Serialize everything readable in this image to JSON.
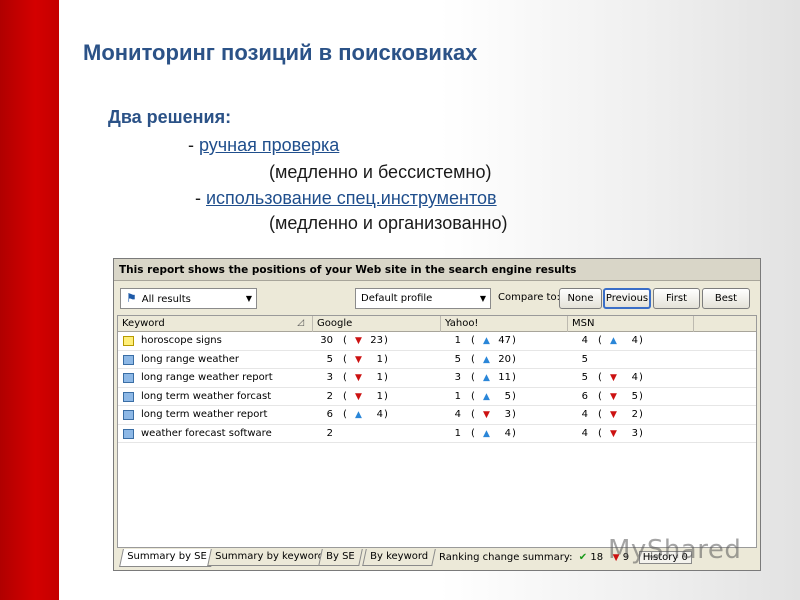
{
  "slide": {
    "title": "Мониторинг позиций в поисковиках",
    "heading": "Два решения:",
    "item1_prefix": "- ",
    "item1_link": "ручная проверка",
    "item1_note": "(медленно и бессистемно)",
    "item2_prefix": "- ",
    "item2_link": "использование спец.инструментов",
    "item2_note": "(медленно и организованно)"
  },
  "app": {
    "header": "This report shows the positions of your Web site in the search engine results",
    "results_filter": "All results",
    "profile": "Default profile",
    "compare_label": "Compare to:",
    "buttons": [
      "None",
      "Previous",
      "First",
      "Best"
    ],
    "active_button": "Previous",
    "columns": [
      "Keyword",
      "Google",
      "Yahoo!",
      "MSN"
    ],
    "rows": [
      {
        "keyword": "horoscope signs",
        "icon_color": "yellow",
        "google": {
          "pos": "30",
          "dir": "down",
          "prev": "23"
        },
        "yahoo": {
          "pos": "1",
          "dir": "up",
          "prev": "47"
        },
        "msn": {
          "pos": "4",
          "dir": "up",
          "prev": "4"
        }
      },
      {
        "keyword": "long range weather",
        "icon_color": "blue",
        "google": {
          "pos": "5",
          "dir": "down",
          "prev": "1"
        },
        "yahoo": {
          "pos": "5",
          "dir": "up",
          "prev": "20"
        },
        "msn": {
          "pos": "5",
          "dir": "",
          "prev": ""
        }
      },
      {
        "keyword": "long range weather report",
        "icon_color": "blue",
        "google": {
          "pos": "3",
          "dir": "down",
          "prev": "1"
        },
        "yahoo": {
          "pos": "3",
          "dir": "up",
          "prev": "11"
        },
        "msn": {
          "pos": "5",
          "dir": "down",
          "prev": "4"
        }
      },
      {
        "keyword": "long term weather forcast",
        "icon_color": "blue",
        "google": {
          "pos": "2",
          "dir": "down",
          "prev": "1"
        },
        "yahoo": {
          "pos": "1",
          "dir": "up",
          "prev": "5"
        },
        "msn": {
          "pos": "6",
          "dir": "down",
          "prev": "5"
        }
      },
      {
        "keyword": "long term weather report",
        "icon_color": "blue",
        "google": {
          "pos": "6",
          "dir": "up",
          "prev": "4"
        },
        "yahoo": {
          "pos": "4",
          "dir": "down",
          "prev": "3"
        },
        "msn": {
          "pos": "4",
          "dir": "down",
          "prev": "2"
        }
      },
      {
        "keyword": "weather forecast software",
        "icon_color": "blue",
        "google": {
          "pos": "2",
          "dir": "",
          "prev": ""
        },
        "yahoo": {
          "pos": "1",
          "dir": "up",
          "prev": "4"
        },
        "msn": {
          "pos": "4",
          "dir": "down",
          "prev": "3"
        }
      }
    ],
    "tabs": [
      "Summary by SE",
      "Summary by keyword",
      "By SE",
      "By keyword"
    ],
    "summary_label": "Ranking change summary:",
    "summary_up": "18",
    "summary_down": "9",
    "summary_history": "History 0"
  },
  "watermark": "MyShared",
  "colors": {
    "accent_red": "#c40000",
    "title_blue": "#2b5287",
    "up_arrow": "#2a86d8",
    "down_arrow": "#cc1111"
  }
}
